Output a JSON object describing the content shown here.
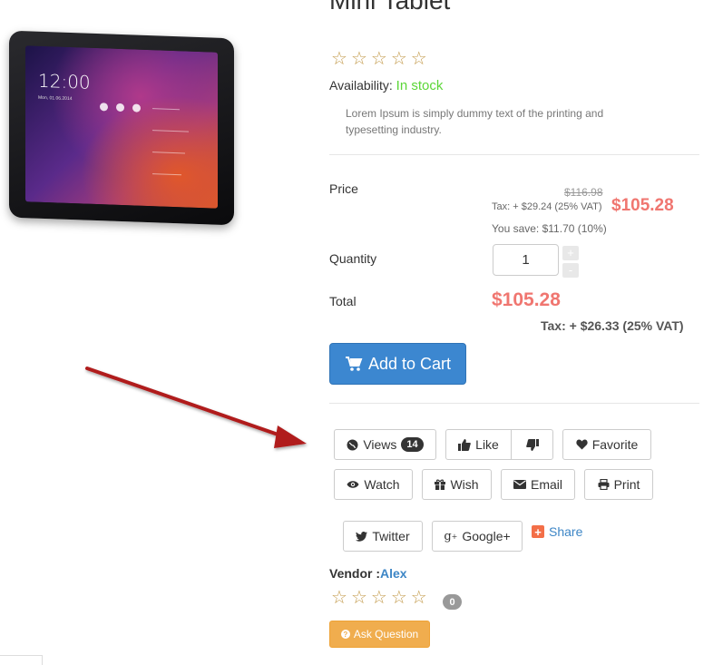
{
  "product": {
    "title": "Mini Tablet",
    "rating_stars": 5,
    "availability_label": "Availability:",
    "availability_value": "In stock",
    "description": "Lorem Ipsum is simply dummy text of the printing and typesetting industry."
  },
  "pricing": {
    "price_label": "Price",
    "old_price": "$116.98",
    "tax_line": "Tax: + $29.24 (25% VAT)",
    "price": "$105.28",
    "you_save": "You save: $11.70 (10%)",
    "quantity_label": "Quantity",
    "quantity_value": "1",
    "increment": "+",
    "decrement": "-",
    "total_label": "Total",
    "total": "$105.28",
    "total_tax": "Tax: + $26.33 (25% VAT)"
  },
  "cart": {
    "add_to_cart_label": "Add to Cart",
    "icon": "shopping-cart-icon"
  },
  "actions": {
    "views_label": "Views",
    "views_count": "14",
    "like_label": "Like",
    "favorite_label": "Favorite",
    "watch_label": "Watch",
    "wish_label": "Wish",
    "email_label": "Email",
    "print_label": "Print",
    "twitter_label": "Twitter",
    "google_label": "Google+",
    "share_label": "Share"
  },
  "vendor": {
    "label": "Vendor :",
    "name": "Alex",
    "rating_count": "0",
    "ask_question_label": "Ask Question"
  },
  "colors": {
    "price": "#f07670",
    "in_stock": "#5cd638",
    "primary_button": "#3c87d0",
    "ask_button": "#f0ad4e",
    "arrow": "#b01d1d",
    "star": "#c39a4a"
  }
}
